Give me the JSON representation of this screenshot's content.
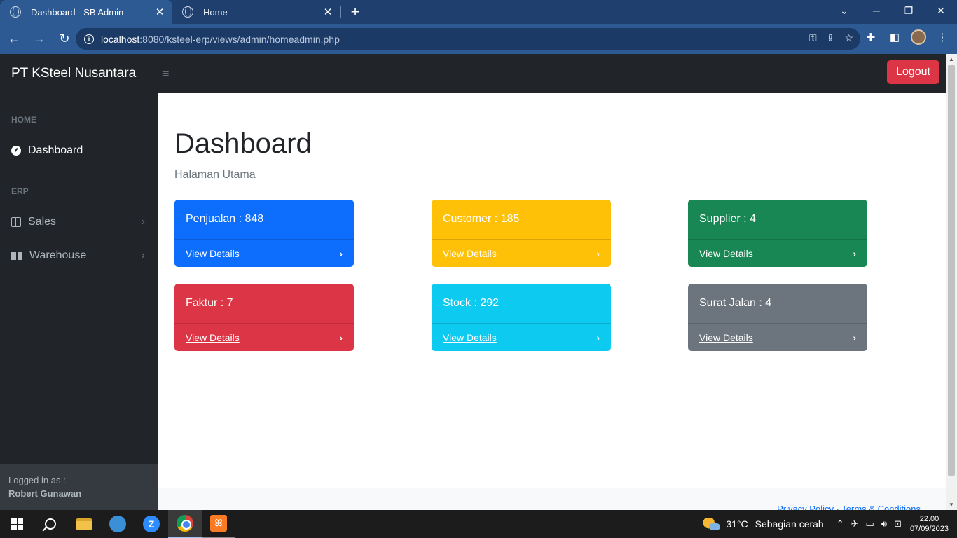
{
  "browser": {
    "tabs": [
      {
        "title": "Dashboard - SB Admin",
        "active": true
      },
      {
        "title": "Home",
        "active": false
      }
    ],
    "url_host": "localhost",
    "url_path": ":8080/ksteel-erp/views/admin/homeadmin.php"
  },
  "topnav": {
    "brand": "PT KSteel Nusantara",
    "logout_label": "Logout"
  },
  "sidebar": {
    "sections": [
      {
        "heading": "HOME",
        "items": [
          {
            "label": "Dashboard",
            "icon": "gauge-icon",
            "active": true
          }
        ]
      },
      {
        "heading": "ERP",
        "items": [
          {
            "label": "Sales",
            "icon": "columns-icon",
            "active": false
          },
          {
            "label": "Warehouse",
            "icon": "book-icon",
            "active": false
          }
        ]
      }
    ],
    "footer_label": "Logged in as :",
    "footer_user": "Robert Gunawan"
  },
  "main": {
    "title": "Dashboard",
    "subtitle": "Halaman Utama",
    "cards": [
      {
        "label": "Penjualan : 848",
        "link": "View Details",
        "color": "#0d6efd"
      },
      {
        "label": "Customer : 185",
        "link": "View Details",
        "color": "#ffc107"
      },
      {
        "label": "Supplier : 4",
        "link": "View Details",
        "color": "#198754"
      },
      {
        "label": "Faktur : 7",
        "link": "View Details",
        "color": "#dc3545"
      },
      {
        "label": "Stock : 292",
        "link": "View Details",
        "color": "#0dcaf0"
      },
      {
        "label": "Surat Jalan : 4",
        "link": "View Details",
        "color": "#6c757d"
      }
    ]
  },
  "footer": {
    "links": "Privacy Policy · Terms & Conditions"
  },
  "taskbar": {
    "weather_temp": "31°C",
    "weather_text": "Sebagian cerah",
    "time": "22.00",
    "date": "07/09/2023"
  }
}
